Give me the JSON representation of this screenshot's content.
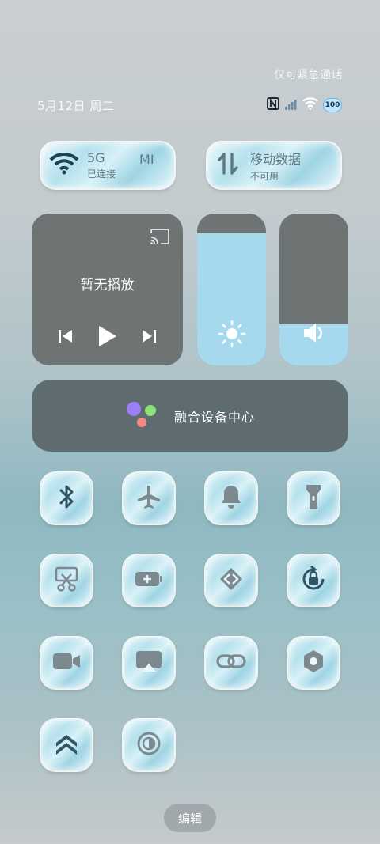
{
  "status": {
    "emergency_text": "仅可紧急通话",
    "date_text": "5月12日 周二",
    "battery_level": "100",
    "icons": [
      "nfc-icon",
      "signal-icon",
      "wifi-icon",
      "battery-icon"
    ]
  },
  "connectivity": {
    "wifi": {
      "name": "5G",
      "brand": "MI",
      "state": "已连接",
      "icon": "wifi-icon"
    },
    "mobile_data": {
      "title": "移动数据",
      "state": "不可用",
      "icon": "data-transfer-icon"
    }
  },
  "media": {
    "title": "暂无播放"
  },
  "brightness": {
    "level_fraction": 0.87,
    "icon": "sun-icon"
  },
  "volume": {
    "level_fraction": 0.27,
    "icon": "speaker-icon"
  },
  "device_center": {
    "label": "融合设备中心"
  },
  "toggles": [
    {
      "id": "bluetooth",
      "icon": "bluetooth-icon",
      "active": true
    },
    {
      "id": "airplane",
      "icon": "airplane-icon",
      "active": false
    },
    {
      "id": "bell",
      "icon": "bell-icon",
      "active": false
    },
    {
      "id": "flashlight",
      "icon": "flashlight-icon",
      "active": false
    },
    {
      "id": "screenshot",
      "icon": "scissors-icon",
      "active": false
    },
    {
      "id": "battery-saver",
      "icon": "battery-plus-icon",
      "active": false
    },
    {
      "id": "code",
      "icon": "chevrons-icon",
      "active": false
    },
    {
      "id": "rotation-lock",
      "icon": "rotation-lock-icon",
      "active": true
    },
    {
      "id": "screen-record",
      "icon": "video-camera-icon",
      "active": false
    },
    {
      "id": "screen-cast",
      "icon": "cast-screen-icon",
      "active": false
    },
    {
      "id": "link",
      "icon": "link-icon",
      "active": false
    },
    {
      "id": "settings",
      "icon": "hex-nut-icon",
      "active": false
    },
    {
      "id": "performance",
      "icon": "double-chevron-up-icon",
      "active": true
    },
    {
      "id": "dark-mode",
      "icon": "contrast-icon",
      "active": false
    }
  ],
  "footer": {
    "edit_label": "编辑"
  }
}
